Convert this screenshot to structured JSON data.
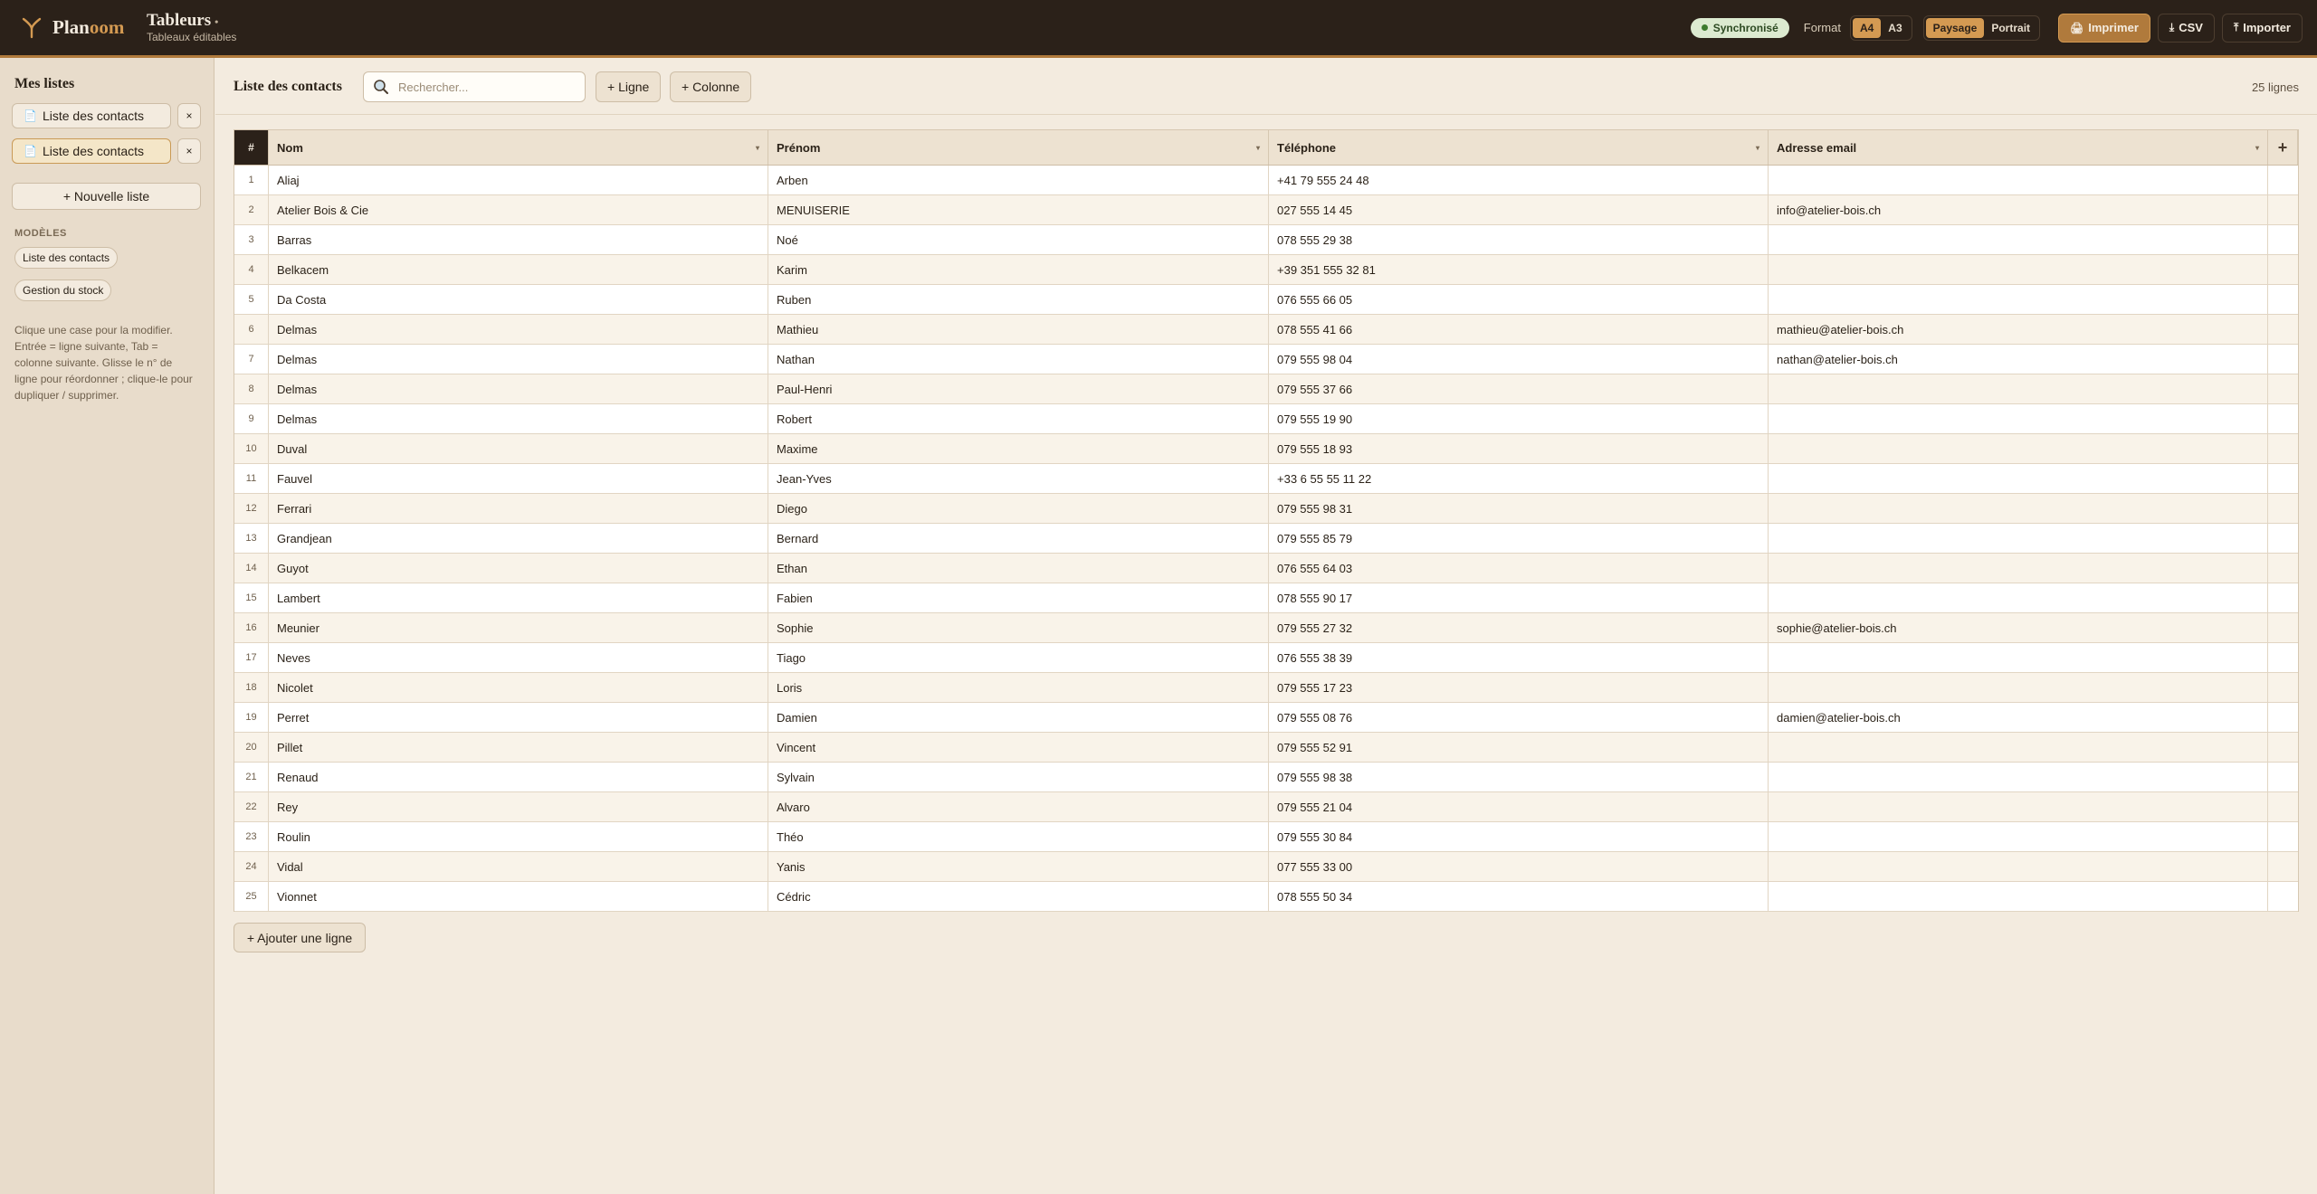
{
  "app": {
    "brand_a": "Plan",
    "brand_b": "oom",
    "title": "Tableurs",
    "title_dot": "•",
    "subtitle": "Tableaux éditables"
  },
  "topbar": {
    "sync": "Synchronisé",
    "format_label": "Format",
    "formats": [
      "A4",
      "A3"
    ],
    "format_selected": "A4",
    "orientations": [
      "Paysage",
      "Portrait"
    ],
    "orientation_selected": "Paysage",
    "print_label": "Imprimer",
    "csv_label": "CSV",
    "import_label": "Importer"
  },
  "sidebar": {
    "title": "Mes listes",
    "lists": [
      {
        "label": "Liste des contacts",
        "active": false
      },
      {
        "label": "Liste des contacts",
        "active": true
      }
    ],
    "close_glyph": "×",
    "new_list": "+ Nouvelle liste",
    "templates_heading": "MODÈLES",
    "templates": [
      "Liste des contacts",
      "Gestion du stock"
    ],
    "hint": "Clique une case pour la modifier. Entrée = ligne suivante, Tab = colonne suivante. Glisse le n° de ligne pour réordonner ; clique-le pour dupliquer / supprimer."
  },
  "main": {
    "title": "Liste des contacts",
    "search_placeholder": "Rechercher...",
    "add_row": "+ Ligne",
    "add_column": "+ Colonne",
    "row_count": "25 lignes",
    "add_row_bottom": "+ Ajouter une ligne"
  },
  "table": {
    "index_header": "#",
    "add_col_glyph": "+",
    "columns": [
      "Nom",
      "Prénom",
      "Téléphone",
      "Adresse email"
    ],
    "rows": [
      [
        "Aliaj",
        "Arben",
        "+41 79 555 24 48",
        ""
      ],
      [
        "Atelier Bois & Cie",
        "MENUISERIE",
        "027 555 14 45",
        "info@atelier-bois.ch"
      ],
      [
        "Barras",
        "Noé",
        "078 555 29 38",
        ""
      ],
      [
        "Belkacem",
        "Karim",
        "+39 351 555 32 81",
        ""
      ],
      [
        "Da Costa",
        "Ruben",
        "076 555 66 05",
        ""
      ],
      [
        "Delmas",
        "Mathieu",
        "078 555 41 66",
        "mathieu@atelier-bois.ch"
      ],
      [
        "Delmas",
        "Nathan",
        "079 555 98 04",
        "nathan@atelier-bois.ch"
      ],
      [
        "Delmas",
        "Paul-Henri",
        "079 555 37 66",
        ""
      ],
      [
        "Delmas",
        "Robert",
        "079 555 19 90",
        ""
      ],
      [
        "Duval",
        "Maxime",
        "079 555 18 93",
        ""
      ],
      [
        "Fauvel",
        "Jean-Yves",
        "+33 6 55 55 11 22",
        ""
      ],
      [
        "Ferrari",
        "Diego",
        "079 555 98 31",
        ""
      ],
      [
        "Grandjean",
        "Bernard",
        "079 555 85 79",
        ""
      ],
      [
        "Guyot",
        "Ethan",
        "076 555 64 03",
        ""
      ],
      [
        "Lambert",
        "Fabien",
        "078 555 90 17",
        ""
      ],
      [
        "Meunier",
        "Sophie",
        "079 555 27 32",
        "sophie@atelier-bois.ch"
      ],
      [
        "Neves",
        "Tiago",
        "076 555 38 39",
        ""
      ],
      [
        "Nicolet",
        "Loris",
        "079 555 17 23",
        ""
      ],
      [
        "Perret",
        "Damien",
        "079 555 08 76",
        "damien@atelier-bois.ch"
      ],
      [
        "Pillet",
        "Vincent",
        "079 555 52 91",
        ""
      ],
      [
        "Renaud",
        "Sylvain",
        "079 555 98 38",
        ""
      ],
      [
        "Rey",
        "Alvaro",
        "079 555 21 04",
        ""
      ],
      [
        "Roulin",
        "Théo",
        "079 555 30 84",
        ""
      ],
      [
        "Vidal",
        "Yanis",
        "077 555 33 00",
        ""
      ],
      [
        "Vionnet",
        "Cédric",
        "078 555 50 34",
        ""
      ]
    ]
  },
  "colors": {
    "topbar_bg": "#2b2119",
    "accent": "#b07a3c",
    "accent_light": "#d49a52",
    "page_bg": "#f3ebdf",
    "sidebar_bg": "#e8dccb",
    "sync_bg": "#dcead0"
  },
  "icons": {
    "logo": "y-fork-logo-icon",
    "list": "document-icon",
    "search": "magnifier-icon",
    "print": "printer-icon",
    "csv": "download-icon",
    "import": "upload-icon",
    "sort": "sort-caret-icon"
  }
}
